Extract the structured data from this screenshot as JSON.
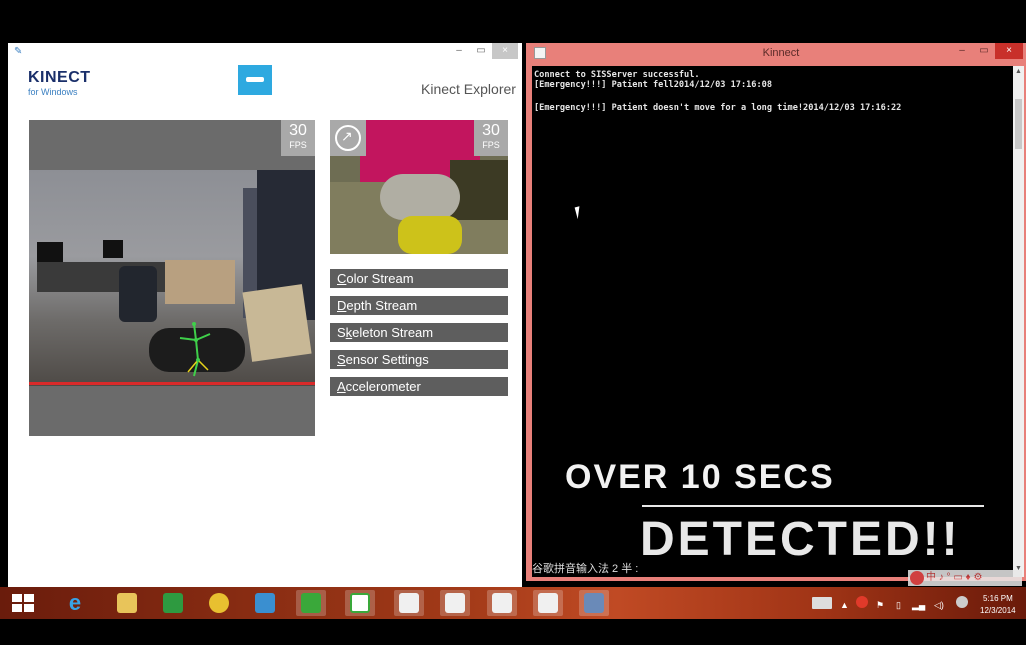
{
  "kinect_explorer": {
    "logo_main": "KINECT",
    "logo_sub": "for Windows",
    "app_name": "Kinect Explorer",
    "main_fps": {
      "value": "30",
      "label": "FPS"
    },
    "depth_fps": {
      "value": "30",
      "label": "FPS"
    },
    "menu": [
      {
        "key": "C",
        "rest": "olor Stream"
      },
      {
        "key": "D",
        "rest": "epth Stream"
      },
      {
        "key": "S",
        "rest": "keleton Stream",
        "prefix": "S"
      },
      {
        "key": "S",
        "rest": "ensor Settings"
      },
      {
        "key": "A",
        "rest": "ccelerometer"
      }
    ],
    "menu_labels": [
      "Color Stream",
      "Depth Stream",
      "Skeleton Stream",
      "Sensor Settings",
      "Accelerometer"
    ]
  },
  "console": {
    "title": "Kinnect",
    "lines": [
      "Connect to SISServer successful.",
      "[Emergency!!!] Patient fell2014/12/03 17:16:08",
      "",
      "[Emergency!!!] Patient doesn't move for a long time!2014/12/03 17:16:22"
    ],
    "ime_status": "谷歌拼音输入法 2 半 :"
  },
  "overlay": {
    "line1": "OVER 10 SECS",
    "line2": "DETECTED!!"
  },
  "taskbar": {
    "clock_time": "5:16 PM",
    "clock_date": "12/3/2014",
    "ime_tray": "中 ♪ ° ▭ ♦ ⚙"
  },
  "colors": {
    "console_frame": "#e8807a",
    "taskbar": "#a23a18",
    "kinect_accent": "#2ea9e0",
    "depth_pink": "#c2155e"
  }
}
